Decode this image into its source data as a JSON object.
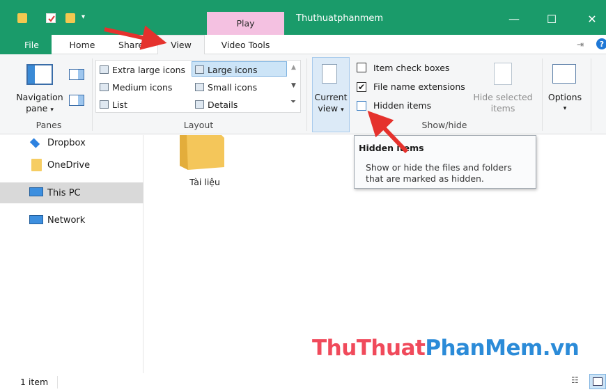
{
  "window": {
    "title": "Thuthuatphanmem",
    "context_tab": "Play"
  },
  "tabs": {
    "file": "File",
    "home": "Home",
    "share": "Share",
    "view": "View",
    "video_tools": "Video Tools"
  },
  "ribbon": {
    "panes": {
      "navigation_pane_line1": "Navigation",
      "navigation_pane_line2": "pane",
      "group_label": "Panes"
    },
    "layout": {
      "items": [
        "Extra large icons",
        "Large icons",
        "Medium icons",
        "Small icons",
        "List",
        "Details"
      ],
      "selected": "Large icons",
      "group_label": "Layout"
    },
    "current_view": {
      "line1": "Current",
      "line2": "view"
    },
    "show_hide": {
      "item_check_boxes": "Item check boxes",
      "file_name_extensions": "File name extensions",
      "hidden_items": "Hidden items",
      "hide_selected_line1": "Hide selected",
      "hide_selected_line2": "items",
      "group_label": "Show/hide",
      "checked": {
        "item_check_boxes": false,
        "file_name_extensions": true,
        "hidden_items": false
      }
    },
    "options": {
      "label": "Options"
    }
  },
  "nav": {
    "items": [
      "Dropbox",
      "OneDrive",
      "This PC",
      "Network"
    ],
    "selected": "This PC"
  },
  "content": {
    "folder_name": "Tài liệu"
  },
  "tooltip": {
    "title": "Hidden items",
    "body_line1": "Show or hide the files and folders",
    "body_line2": "that are marked as hidden."
  },
  "status": {
    "count": "1 item"
  },
  "watermark": {
    "part1": "ThuThuat",
    "part2": "PhanMem",
    "part3": ".vn"
  },
  "colors": {
    "title_bar": "#1a9b6a",
    "context_tab": "#f4c1e1",
    "arrow": "#e5322d",
    "selection": "#cce4f7"
  }
}
